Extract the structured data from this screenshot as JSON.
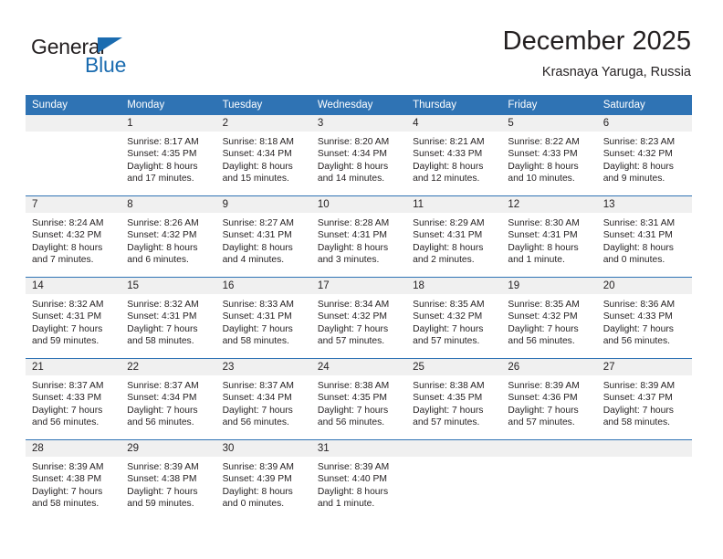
{
  "brand": {
    "word1": "General",
    "word2": "Blue",
    "accent_color": "#1b6cb0",
    "triangle_icon": "triangle-icon"
  },
  "header": {
    "title": "December 2025",
    "subtitle": "Krasnaya Yaruga, Russia"
  },
  "calendar": {
    "header_bg": "#2f73b4",
    "daynum_bg": "#f0f0f0",
    "weekday_headers": [
      "Sunday",
      "Monday",
      "Tuesday",
      "Wednesday",
      "Thursday",
      "Friday",
      "Saturday"
    ],
    "weeks": [
      [
        {
          "day": "",
          "sunrise": "",
          "sunset": "",
          "daylight1": "",
          "daylight2": ""
        },
        {
          "day": "1",
          "sunrise": "Sunrise: 8:17 AM",
          "sunset": "Sunset: 4:35 PM",
          "daylight1": "Daylight: 8 hours",
          "daylight2": "and 17 minutes."
        },
        {
          "day": "2",
          "sunrise": "Sunrise: 8:18 AM",
          "sunset": "Sunset: 4:34 PM",
          "daylight1": "Daylight: 8 hours",
          "daylight2": "and 15 minutes."
        },
        {
          "day": "3",
          "sunrise": "Sunrise: 8:20 AM",
          "sunset": "Sunset: 4:34 PM",
          "daylight1": "Daylight: 8 hours",
          "daylight2": "and 14 minutes."
        },
        {
          "day": "4",
          "sunrise": "Sunrise: 8:21 AM",
          "sunset": "Sunset: 4:33 PM",
          "daylight1": "Daylight: 8 hours",
          "daylight2": "and 12 minutes."
        },
        {
          "day": "5",
          "sunrise": "Sunrise: 8:22 AM",
          "sunset": "Sunset: 4:33 PM",
          "daylight1": "Daylight: 8 hours",
          "daylight2": "and 10 minutes."
        },
        {
          "day": "6",
          "sunrise": "Sunrise: 8:23 AM",
          "sunset": "Sunset: 4:32 PM",
          "daylight1": "Daylight: 8 hours",
          "daylight2": "and 9 minutes."
        }
      ],
      [
        {
          "day": "7",
          "sunrise": "Sunrise: 8:24 AM",
          "sunset": "Sunset: 4:32 PM",
          "daylight1": "Daylight: 8 hours",
          "daylight2": "and 7 minutes."
        },
        {
          "day": "8",
          "sunrise": "Sunrise: 8:26 AM",
          "sunset": "Sunset: 4:32 PM",
          "daylight1": "Daylight: 8 hours",
          "daylight2": "and 6 minutes."
        },
        {
          "day": "9",
          "sunrise": "Sunrise: 8:27 AM",
          "sunset": "Sunset: 4:31 PM",
          "daylight1": "Daylight: 8 hours",
          "daylight2": "and 4 minutes."
        },
        {
          "day": "10",
          "sunrise": "Sunrise: 8:28 AM",
          "sunset": "Sunset: 4:31 PM",
          "daylight1": "Daylight: 8 hours",
          "daylight2": "and 3 minutes."
        },
        {
          "day": "11",
          "sunrise": "Sunrise: 8:29 AM",
          "sunset": "Sunset: 4:31 PM",
          "daylight1": "Daylight: 8 hours",
          "daylight2": "and 2 minutes."
        },
        {
          "day": "12",
          "sunrise": "Sunrise: 8:30 AM",
          "sunset": "Sunset: 4:31 PM",
          "daylight1": "Daylight: 8 hours",
          "daylight2": "and 1 minute."
        },
        {
          "day": "13",
          "sunrise": "Sunrise: 8:31 AM",
          "sunset": "Sunset: 4:31 PM",
          "daylight1": "Daylight: 8 hours",
          "daylight2": "and 0 minutes."
        }
      ],
      [
        {
          "day": "14",
          "sunrise": "Sunrise: 8:32 AM",
          "sunset": "Sunset: 4:31 PM",
          "daylight1": "Daylight: 7 hours",
          "daylight2": "and 59 minutes."
        },
        {
          "day": "15",
          "sunrise": "Sunrise: 8:32 AM",
          "sunset": "Sunset: 4:31 PM",
          "daylight1": "Daylight: 7 hours",
          "daylight2": "and 58 minutes."
        },
        {
          "day": "16",
          "sunrise": "Sunrise: 8:33 AM",
          "sunset": "Sunset: 4:31 PM",
          "daylight1": "Daylight: 7 hours",
          "daylight2": "and 58 minutes."
        },
        {
          "day": "17",
          "sunrise": "Sunrise: 8:34 AM",
          "sunset": "Sunset: 4:32 PM",
          "daylight1": "Daylight: 7 hours",
          "daylight2": "and 57 minutes."
        },
        {
          "day": "18",
          "sunrise": "Sunrise: 8:35 AM",
          "sunset": "Sunset: 4:32 PM",
          "daylight1": "Daylight: 7 hours",
          "daylight2": "and 57 minutes."
        },
        {
          "day": "19",
          "sunrise": "Sunrise: 8:35 AM",
          "sunset": "Sunset: 4:32 PM",
          "daylight1": "Daylight: 7 hours",
          "daylight2": "and 56 minutes."
        },
        {
          "day": "20",
          "sunrise": "Sunrise: 8:36 AM",
          "sunset": "Sunset: 4:33 PM",
          "daylight1": "Daylight: 7 hours",
          "daylight2": "and 56 minutes."
        }
      ],
      [
        {
          "day": "21",
          "sunrise": "Sunrise: 8:37 AM",
          "sunset": "Sunset: 4:33 PM",
          "daylight1": "Daylight: 7 hours",
          "daylight2": "and 56 minutes."
        },
        {
          "day": "22",
          "sunrise": "Sunrise: 8:37 AM",
          "sunset": "Sunset: 4:34 PM",
          "daylight1": "Daylight: 7 hours",
          "daylight2": "and 56 minutes."
        },
        {
          "day": "23",
          "sunrise": "Sunrise: 8:37 AM",
          "sunset": "Sunset: 4:34 PM",
          "daylight1": "Daylight: 7 hours",
          "daylight2": "and 56 minutes."
        },
        {
          "day": "24",
          "sunrise": "Sunrise: 8:38 AM",
          "sunset": "Sunset: 4:35 PM",
          "daylight1": "Daylight: 7 hours",
          "daylight2": "and 56 minutes."
        },
        {
          "day": "25",
          "sunrise": "Sunrise: 8:38 AM",
          "sunset": "Sunset: 4:35 PM",
          "daylight1": "Daylight: 7 hours",
          "daylight2": "and 57 minutes."
        },
        {
          "day": "26",
          "sunrise": "Sunrise: 8:39 AM",
          "sunset": "Sunset: 4:36 PM",
          "daylight1": "Daylight: 7 hours",
          "daylight2": "and 57 minutes."
        },
        {
          "day": "27",
          "sunrise": "Sunrise: 8:39 AM",
          "sunset": "Sunset: 4:37 PM",
          "daylight1": "Daylight: 7 hours",
          "daylight2": "and 58 minutes."
        }
      ],
      [
        {
          "day": "28",
          "sunrise": "Sunrise: 8:39 AM",
          "sunset": "Sunset: 4:38 PM",
          "daylight1": "Daylight: 7 hours",
          "daylight2": "and 58 minutes."
        },
        {
          "day": "29",
          "sunrise": "Sunrise: 8:39 AM",
          "sunset": "Sunset: 4:38 PM",
          "daylight1": "Daylight: 7 hours",
          "daylight2": "and 59 minutes."
        },
        {
          "day": "30",
          "sunrise": "Sunrise: 8:39 AM",
          "sunset": "Sunset: 4:39 PM",
          "daylight1": "Daylight: 8 hours",
          "daylight2": "and 0 minutes."
        },
        {
          "day": "31",
          "sunrise": "Sunrise: 8:39 AM",
          "sunset": "Sunset: 4:40 PM",
          "daylight1": "Daylight: 8 hours",
          "daylight2": "and 1 minute."
        },
        {
          "day": "",
          "sunrise": "",
          "sunset": "",
          "daylight1": "",
          "daylight2": ""
        },
        {
          "day": "",
          "sunrise": "",
          "sunset": "",
          "daylight1": "",
          "daylight2": ""
        },
        {
          "day": "",
          "sunrise": "",
          "sunset": "",
          "daylight1": "",
          "daylight2": ""
        }
      ]
    ]
  }
}
